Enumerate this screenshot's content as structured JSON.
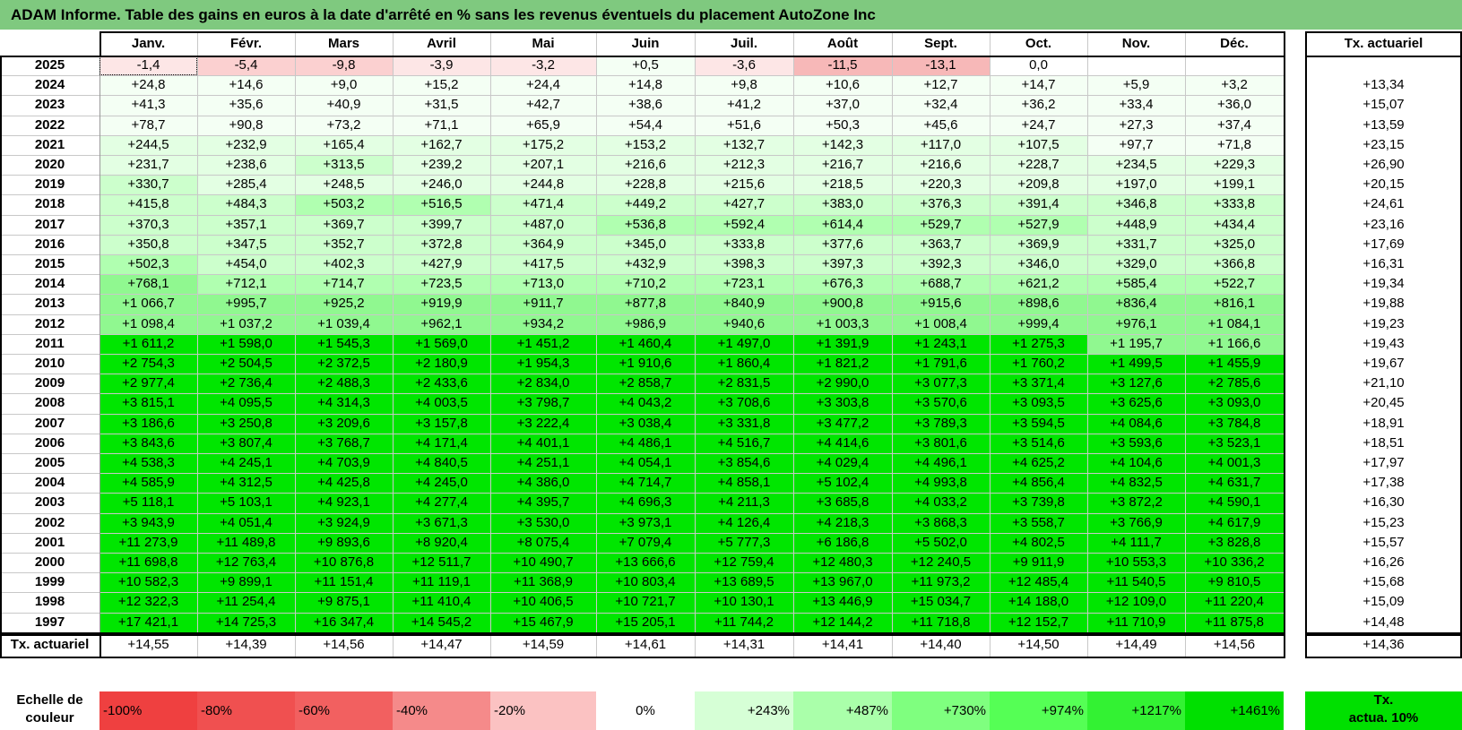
{
  "title": "ADAM Informe. Table des gains en euros à la date d'arrêté en % sans les revenus éventuels du placement AutoZone Inc",
  "months": [
    "Janv.",
    "Févr.",
    "Mars",
    "Avril",
    "Mai",
    "Juin",
    "Juil.",
    "Août",
    "Sept.",
    "Oct.",
    "Nov.",
    "Déc."
  ],
  "rate_header": "Tx. actuariel",
  "rows": [
    {
      "year": "2025",
      "values": [
        "-1,4",
        "-5,4",
        "-9,8",
        "-3,9",
        "-3,2",
        "+0,5",
        "-3,6",
        "-11,5",
        "-13,1",
        "0,0",
        "",
        ""
      ],
      "rate": ""
    },
    {
      "year": "2024",
      "values": [
        "+24,8",
        "+14,6",
        "+9,0",
        "+15,2",
        "+24,4",
        "+14,8",
        "+9,8",
        "+10,6",
        "+12,7",
        "+14,7",
        "+5,9",
        "+3,2"
      ],
      "rate": "+13,34"
    },
    {
      "year": "2023",
      "values": [
        "+41,3",
        "+35,6",
        "+40,9",
        "+31,5",
        "+42,7",
        "+38,6",
        "+41,2",
        "+37,0",
        "+32,4",
        "+36,2",
        "+33,4",
        "+36,0"
      ],
      "rate": "+15,07"
    },
    {
      "year": "2022",
      "values": [
        "+78,7",
        "+90,8",
        "+73,2",
        "+71,1",
        "+65,9",
        "+54,4",
        "+51,6",
        "+50,3",
        "+45,6",
        "+24,7",
        "+27,3",
        "+37,4"
      ],
      "rate": "+13,59"
    },
    {
      "year": "2021",
      "values": [
        "+244,5",
        "+232,9",
        "+165,4",
        "+162,7",
        "+175,2",
        "+153,2",
        "+132,7",
        "+142,3",
        "+117,0",
        "+107,5",
        "+97,7",
        "+71,8"
      ],
      "rate": "+23,15"
    },
    {
      "year": "2020",
      "values": [
        "+231,7",
        "+238,6",
        "+313,5",
        "+239,2",
        "+207,1",
        "+216,6",
        "+212,3",
        "+216,7",
        "+216,6",
        "+228,7",
        "+234,5",
        "+229,3"
      ],
      "rate": "+26,90"
    },
    {
      "year": "2019",
      "values": [
        "+330,7",
        "+285,4",
        "+248,5",
        "+246,0",
        "+244,8",
        "+228,8",
        "+215,6",
        "+218,5",
        "+220,3",
        "+209,8",
        "+197,0",
        "+199,1"
      ],
      "rate": "+20,15"
    },
    {
      "year": "2018",
      "values": [
        "+415,8",
        "+484,3",
        "+503,2",
        "+516,5",
        "+471,4",
        "+449,2",
        "+427,7",
        "+383,0",
        "+376,3",
        "+391,4",
        "+346,8",
        "+333,8"
      ],
      "rate": "+24,61"
    },
    {
      "year": "2017",
      "values": [
        "+370,3",
        "+357,1",
        "+369,7",
        "+399,7",
        "+487,0",
        "+536,8",
        "+592,4",
        "+614,4",
        "+529,7",
        "+527,9",
        "+448,9",
        "+434,4"
      ],
      "rate": "+23,16"
    },
    {
      "year": "2016",
      "values": [
        "+350,8",
        "+347,5",
        "+352,7",
        "+372,8",
        "+364,9",
        "+345,0",
        "+333,8",
        "+377,6",
        "+363,7",
        "+369,9",
        "+331,7",
        "+325,0"
      ],
      "rate": "+17,69"
    },
    {
      "year": "2015",
      "values": [
        "+502,3",
        "+454,0",
        "+402,3",
        "+427,9",
        "+417,5",
        "+432,9",
        "+398,3",
        "+397,3",
        "+392,3",
        "+346,0",
        "+329,0",
        "+366,8"
      ],
      "rate": "+16,31"
    },
    {
      "year": "2014",
      "values": [
        "+768,1",
        "+712,1",
        "+714,7",
        "+723,5",
        "+713,0",
        "+710,2",
        "+723,1",
        "+676,3",
        "+688,7",
        "+621,2",
        "+585,4",
        "+522,7"
      ],
      "rate": "+19,34"
    },
    {
      "year": "2013",
      "values": [
        "+1 066,7",
        "+995,7",
        "+925,2",
        "+919,9",
        "+911,7",
        "+877,8",
        "+840,9",
        "+900,8",
        "+915,6",
        "+898,6",
        "+836,4",
        "+816,1"
      ],
      "rate": "+19,88"
    },
    {
      "year": "2012",
      "values": [
        "+1 098,4",
        "+1 037,2",
        "+1 039,4",
        "+962,1",
        "+934,2",
        "+986,9",
        "+940,6",
        "+1 003,3",
        "+1 008,4",
        "+999,4",
        "+976,1",
        "+1 084,1"
      ],
      "rate": "+19,23"
    },
    {
      "year": "2011",
      "values": [
        "+1 611,2",
        "+1 598,0",
        "+1 545,3",
        "+1 569,0",
        "+1 451,2",
        "+1 460,4",
        "+1 497,0",
        "+1 391,9",
        "+1 243,1",
        "+1 275,3",
        "+1 195,7",
        "+1 166,6"
      ],
      "rate": "+19,43"
    },
    {
      "year": "2010",
      "values": [
        "+2 754,3",
        "+2 504,5",
        "+2 372,5",
        "+2 180,9",
        "+1 954,3",
        "+1 910,6",
        "+1 860,4",
        "+1 821,2",
        "+1 791,6",
        "+1 760,2",
        "+1 499,5",
        "+1 455,9"
      ],
      "rate": "+19,67"
    },
    {
      "year": "2009",
      "values": [
        "+2 977,4",
        "+2 736,4",
        "+2 488,3",
        "+2 433,6",
        "+2 834,0",
        "+2 858,7",
        "+2 831,5",
        "+2 990,0",
        "+3 077,3",
        "+3 371,4",
        "+3 127,6",
        "+2 785,6"
      ],
      "rate": "+21,10"
    },
    {
      "year": "2008",
      "values": [
        "+3 815,1",
        "+4 095,5",
        "+4 314,3",
        "+4 003,5",
        "+3 798,7",
        "+4 043,2",
        "+3 708,6",
        "+3 303,8",
        "+3 570,6",
        "+3 093,5",
        "+3 625,6",
        "+3 093,0"
      ],
      "rate": "+20,45"
    },
    {
      "year": "2007",
      "values": [
        "+3 186,6",
        "+3 250,8",
        "+3 209,6",
        "+3 157,8",
        "+3 222,4",
        "+3 038,4",
        "+3 331,8",
        "+3 477,2",
        "+3 789,3",
        "+3 594,5",
        "+4 084,6",
        "+3 784,8"
      ],
      "rate": "+18,91"
    },
    {
      "year": "2006",
      "values": [
        "+3 843,6",
        "+3 807,4",
        "+3 768,7",
        "+4 171,4",
        "+4 401,1",
        "+4 486,1",
        "+4 516,7",
        "+4 414,6",
        "+3 801,6",
        "+3 514,6",
        "+3 593,6",
        "+3 523,1"
      ],
      "rate": "+18,51"
    },
    {
      "year": "2005",
      "values": [
        "+4 538,3",
        "+4 245,1",
        "+4 703,9",
        "+4 840,5",
        "+4 251,1",
        "+4 054,1",
        "+3 854,6",
        "+4 029,4",
        "+4 496,1",
        "+4 625,2",
        "+4 104,6",
        "+4 001,3"
      ],
      "rate": "+17,97"
    },
    {
      "year": "2004",
      "values": [
        "+4 585,9",
        "+4 312,5",
        "+4 425,8",
        "+4 245,0",
        "+4 386,0",
        "+4 714,7",
        "+4 858,1",
        "+5 102,4",
        "+4 993,8",
        "+4 856,4",
        "+4 832,5",
        "+4 631,7"
      ],
      "rate": "+17,38"
    },
    {
      "year": "2003",
      "values": [
        "+5 118,1",
        "+5 103,1",
        "+4 923,1",
        "+4 277,4",
        "+4 395,7",
        "+4 696,3",
        "+4 211,3",
        "+3 685,8",
        "+4 033,2",
        "+3 739,8",
        "+3 872,2",
        "+4 590,1"
      ],
      "rate": "+16,30"
    },
    {
      "year": "2002",
      "values": [
        "+3 943,9",
        "+4 051,4",
        "+3 924,9",
        "+3 671,3",
        "+3 530,0",
        "+3 973,1",
        "+4 126,4",
        "+4 218,3",
        "+3 868,3",
        "+3 558,7",
        "+3 766,9",
        "+4 617,9"
      ],
      "rate": "+15,23"
    },
    {
      "year": "2001",
      "values": [
        "+11 273,9",
        "+11 489,8",
        "+9 893,6",
        "+8 920,4",
        "+8 075,4",
        "+7 079,4",
        "+5 777,3",
        "+6 186,8",
        "+5 502,0",
        "+4 802,5",
        "+4 111,7",
        "+3 828,8"
      ],
      "rate": "+15,57"
    },
    {
      "year": "2000",
      "values": [
        "+11 698,8",
        "+12 763,4",
        "+10 876,8",
        "+12 511,7",
        "+10 490,7",
        "+13 666,6",
        "+12 759,4",
        "+12 480,3",
        "+12 240,5",
        "+9 911,9",
        "+10 553,3",
        "+10 336,2"
      ],
      "rate": "+16,26"
    },
    {
      "year": "1999",
      "values": [
        "+10 582,3",
        "+9 899,1",
        "+11 151,4",
        "+11 119,1",
        "+11 368,9",
        "+10 803,4",
        "+13 689,5",
        "+13 967,0",
        "+11 973,2",
        "+12 485,4",
        "+11 540,5",
        "+9 810,5"
      ],
      "rate": "+15,68"
    },
    {
      "year": "1998",
      "values": [
        "+12 322,3",
        "+11 254,4",
        "+9 875,1",
        "+11 410,4",
        "+10 406,5",
        "+10 721,7",
        "+10 130,1",
        "+13 446,9",
        "+15 034,7",
        "+14 188,0",
        "+12 109,0",
        "+11 220,4"
      ],
      "rate": "+15,09"
    },
    {
      "year": "1997",
      "values": [
        "+17 421,1",
        "+14 725,3",
        "+16 347,4",
        "+14 545,2",
        "+15 467,9",
        "+15 205,1",
        "+11 744,2",
        "+12 144,2",
        "+11 718,8",
        "+12 152,7",
        "+11 710,9",
        "+11 875,8"
      ],
      "rate": "+14,48"
    }
  ],
  "footer": {
    "label": "Tx. actuariel",
    "values": [
      "+14,55",
      "+14,39",
      "+14,56",
      "+14,47",
      "+14,59",
      "+14,61",
      "+14,31",
      "+14,41",
      "+14,40",
      "+14,50",
      "+14,49",
      "+14,56"
    ],
    "rate": "+14,36"
  },
  "scale": {
    "label_line1": "Echelle de",
    "label_line2": "couleur",
    "items": [
      {
        "label": "-100%",
        "color": "#ef4040"
      },
      {
        "label": "-80%",
        "color": "#f05050"
      },
      {
        "label": "-60%",
        "color": "#f26060"
      },
      {
        "label": "-40%",
        "color": "#f58a8a"
      },
      {
        "label": "-20%",
        "color": "#fbc2c2"
      },
      {
        "label": "0%",
        "color": "#ffffff"
      },
      {
        "label": "+243%",
        "color": "#d6ffd6"
      },
      {
        "label": "+487%",
        "color": "#aaffaa"
      },
      {
        "label": "+730%",
        "color": "#7fff7f"
      },
      {
        "label": "+974%",
        "color": "#55ff55"
      },
      {
        "label": "+1217%",
        "color": "#33f233"
      },
      {
        "label": "+1461%",
        "color": "#00e000"
      }
    ],
    "rate_line1": "Tx.",
    "rate_line2": "actua. 10%",
    "rate_color": "#00e000"
  },
  "cell_colors": {
    "negative_strong": "#f7b8b8",
    "negative_medium": "#fbd0d0",
    "negative_light": "#fde6e6",
    "neutral": "#ffffff",
    "green_1": "#f4fff4",
    "green_2": "#e3ffe3",
    "green_3": "#ccffcc",
    "green_4": "#b0ffb0",
    "green_5": "#90f890",
    "green_6": "#00e600"
  }
}
